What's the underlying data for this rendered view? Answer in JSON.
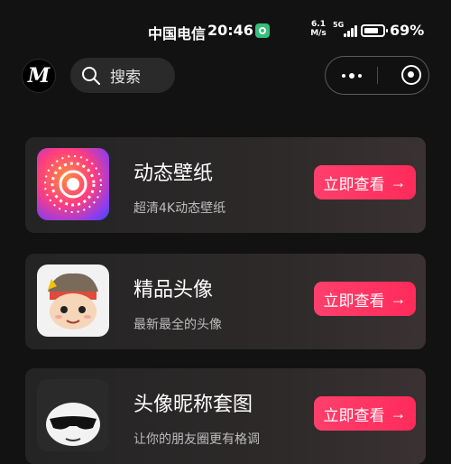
{
  "status_bar": {
    "carrier": "中国电信",
    "time": "20:46",
    "speed": "6.1\nM/s",
    "network": "5G",
    "battery": "69%"
  },
  "nav": {
    "logo_text": "M",
    "search_placeholder": "搜索"
  },
  "cards": [
    {
      "title": "动态壁纸",
      "subtitle": "超清4K动态壁纸",
      "button": "立即查看",
      "icon": "live-wallpaper-icon"
    },
    {
      "title": "精品头像",
      "subtitle": "最新最全的头像",
      "button": "立即查看",
      "icon": "cartoon-avatar-icon"
    },
    {
      "title": "头像昵称套图",
      "subtitle": "让你的朋友圈更有格调",
      "button": "立即查看",
      "icon": "sunglasses-face-icon"
    }
  ],
  "colors": {
    "accent": "#ff3f6c",
    "background": "#121212",
    "card": "#2a2a2a"
  }
}
